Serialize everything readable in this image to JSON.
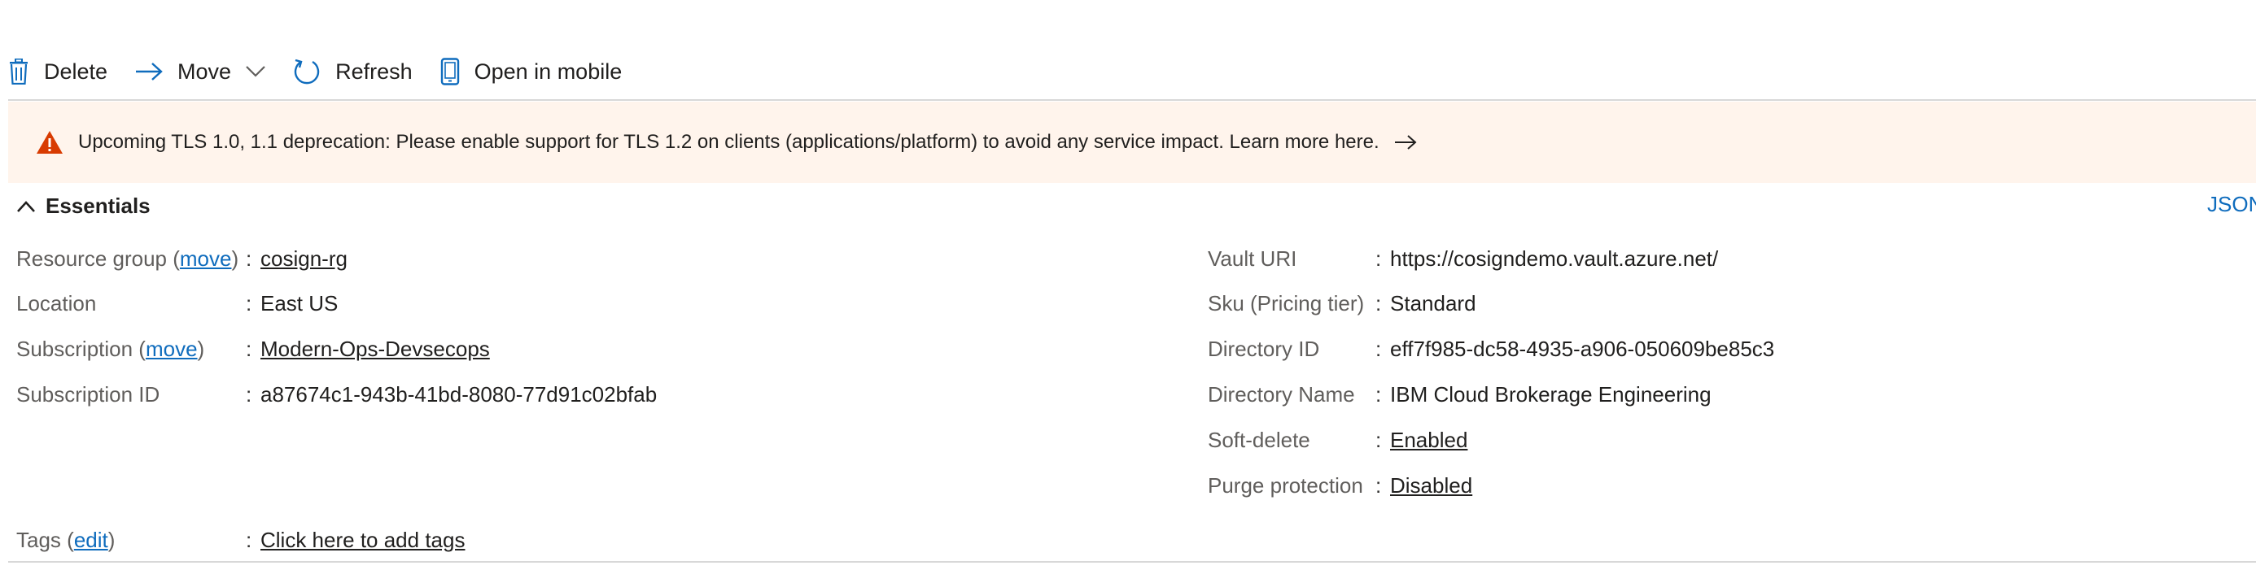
{
  "toolbar": {
    "delete_label": "Delete",
    "move_label": "Move",
    "refresh_label": "Refresh",
    "open_mobile_label": "Open in mobile"
  },
  "banner": {
    "message": "Upcoming TLS 1.0, 1.1 deprecation: Please enable support for TLS 1.2 on clients (applications/platform) to avoid any service impact. Learn more here.",
    "warning_color": "#d83b01"
  },
  "essentials": {
    "title": "Essentials",
    "json_link": "JSON"
  },
  "left": {
    "resource_group": {
      "label_prefix": "Resource group (",
      "link": "move",
      "label_suffix": ")",
      "value": "cosign-rg"
    },
    "location": {
      "label": "Location",
      "value": "East US"
    },
    "subscription": {
      "label_prefix": "Subscription (",
      "link": "move",
      "label_suffix": ")",
      "value": "Modern-Ops-Devsecops"
    },
    "subscription_id": {
      "label": "Subscription ID",
      "value": "a87674c1-943b-41bd-8080-77d91c02bfab"
    }
  },
  "right": {
    "vault_uri": {
      "label": "Vault URI",
      "value": "https://cosigndemo.vault.azure.net/"
    },
    "sku": {
      "label": "Sku (Pricing tier)",
      "value": "Standard"
    },
    "directory_id": {
      "label": "Directory ID",
      "value": "eff7f985-dc58-4935-a906-050609be85c3"
    },
    "directory_name": {
      "label": "Directory Name",
      "value": "IBM Cloud Brokerage Engineering"
    },
    "soft_delete": {
      "label": "Soft-delete",
      "value": "Enabled"
    },
    "purge_protection": {
      "label": "Purge protection",
      "value": "Disabled"
    }
  },
  "tags": {
    "label_prefix": "Tags (",
    "link": "edit",
    "label_suffix": ")",
    "value": "Click here to add tags"
  },
  "colon": ":",
  "colors": {
    "accent": "#0f6cbd",
    "banner_bg": "#fff4ec"
  }
}
